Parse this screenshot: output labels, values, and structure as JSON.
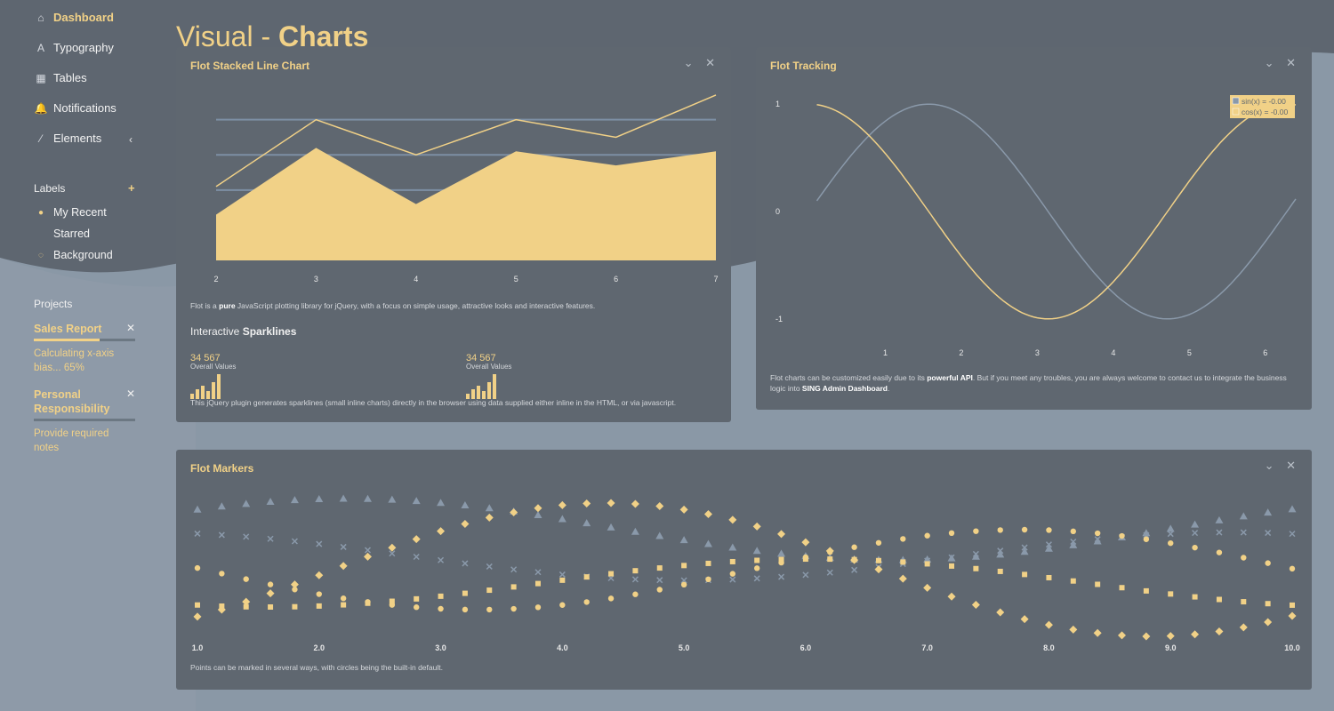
{
  "page_title": {
    "light": "Visual - ",
    "bold": "Charts"
  },
  "sidebar": {
    "nav": [
      {
        "label": "Dashboard",
        "icon": "home-icon",
        "glyph": "⌂",
        "active": true
      },
      {
        "label": "Typography",
        "icon": "typography-icon",
        "glyph": "A"
      },
      {
        "label": "Tables",
        "icon": "table-icon",
        "glyph": "▦"
      },
      {
        "label": "Notifications",
        "icon": "bell-icon",
        "glyph": "🔔"
      },
      {
        "label": "Elements",
        "icon": "wand-icon",
        "glyph": "⁄"
      }
    ],
    "elements_chevron": "‹",
    "labels_title": "Labels",
    "labels_add": "+",
    "labels": [
      {
        "label": "My Recent",
        "glyph": "●",
        "color": "#f1d187"
      },
      {
        "label": "Starred",
        "glyph": "",
        "color": "#f1d187"
      },
      {
        "label": "Background",
        "glyph": "◌",
        "color": "#f1d187"
      }
    ],
    "projects_title": "Projects",
    "projects": [
      {
        "title": "Sales Report",
        "text": "Calculating x-axis bias... 65%",
        "progress": 0.65
      },
      {
        "title": "Personal Responsibility",
        "text": "Provide required notes",
        "progress": 0.0
      }
    ]
  },
  "panels": {
    "stacked": {
      "title": "Flot Stacked Line Chart",
      "desc_pre": "Flot is a ",
      "desc_bold": "pure",
      "desc_post": " JavaScript plotting library for jQuery, with a focus on simple usage, attractive looks and interactive features.",
      "spark_head_pre": "Interactive ",
      "spark_head_bold": "Sparklines",
      "sparks": [
        {
          "value": "34 567",
          "label": "Overall Values",
          "bars": [
            3,
            6,
            8,
            5,
            10,
            15
          ]
        },
        {
          "value": "34 567",
          "label": "Overall Values",
          "bars": [
            3,
            6,
            8,
            5,
            10,
            15
          ]
        }
      ],
      "spark_desc": "This jQuery plugin generates sparklines (small inline charts) directly in the browser using data supplied either inline in the HTML, or via javascript."
    },
    "tracking": {
      "title": "Flot Tracking",
      "legend": [
        "sin(x) = -0.00",
        "cos(x) = -0.00"
      ],
      "desc_pre": "Flot charts can be customized easily due to its ",
      "desc_bold1": "powerful API",
      "desc_mid": ". But if you meet any troubles, you are always welcome to contact us to integrate the business logic into ",
      "desc_bold2": "SING Admin Dashboard",
      "desc_post": "."
    },
    "markers": {
      "title": "Flot Markers",
      "desc": "Points can be marked in several ways, with circles being the built-in default."
    },
    "ctrl_collapse": "⌄",
    "ctrl_close": "✕"
  },
  "colors": {
    "accent": "#f1d187",
    "panel": "#5f6770",
    "grey_line": "#8a99aa"
  },
  "chart_data": [
    {
      "type": "area",
      "title": "Flot Stacked Line Chart",
      "x": [
        2,
        3,
        4,
        5,
        6,
        7
      ],
      "series": [
        {
          "values": [
            13,
            32,
            16,
            31,
            27,
            31
          ]
        },
        {
          "values": [
            21,
            40,
            30,
            40,
            35,
            47
          ]
        }
      ],
      "xlim": [
        2,
        7
      ],
      "ylim": [
        0,
        48
      ],
      "grid_y": [
        20,
        30,
        40
      ],
      "xticks": [
        "2",
        "3",
        "4",
        "5",
        "6",
        "7"
      ]
    },
    {
      "type": "line",
      "title": "Flot Tracking",
      "x_range": [
        0.1,
        6.4
      ],
      "series": [
        {
          "name": "sin(x)",
          "function": "sin"
        },
        {
          "name": "cos(x)",
          "function": "cos"
        }
      ],
      "xlim": [
        0,
        6.4
      ],
      "ylim": [
        -1.2,
        1.2
      ],
      "xticks": [
        "1",
        "2",
        "3",
        "4",
        "5",
        "6"
      ],
      "yticks": [
        "1",
        "0",
        "-1"
      ],
      "legend": "top-right"
    },
    {
      "type": "scatter",
      "title": "Flot Markers",
      "xlim": [
        1.0,
        10.0
      ],
      "ylim": [
        0,
        11
      ],
      "xticks": [
        "1.0",
        "2.0",
        "3.0",
        "4.0",
        "5.0",
        "6.0",
        "7.0",
        "8.0",
        "9.0",
        "10.0"
      ],
      "series": [
        {
          "marker": "triangle",
          "offset": 8,
          "amp": 2.3,
          "phase": 0.0
        },
        {
          "marker": "cross",
          "offset": 6,
          "amp": 1.8,
          "phase": 1.2
        },
        {
          "marker": "circle",
          "offset": 5,
          "amp": 3.0,
          "phase": 2.4
        },
        {
          "marker": "square",
          "offset": 4,
          "amp": 1.8,
          "phase": 3.6
        },
        {
          "marker": "diamond",
          "offset": 5,
          "amp": 5.0,
          "phase": 4.8
        }
      ]
    }
  ]
}
